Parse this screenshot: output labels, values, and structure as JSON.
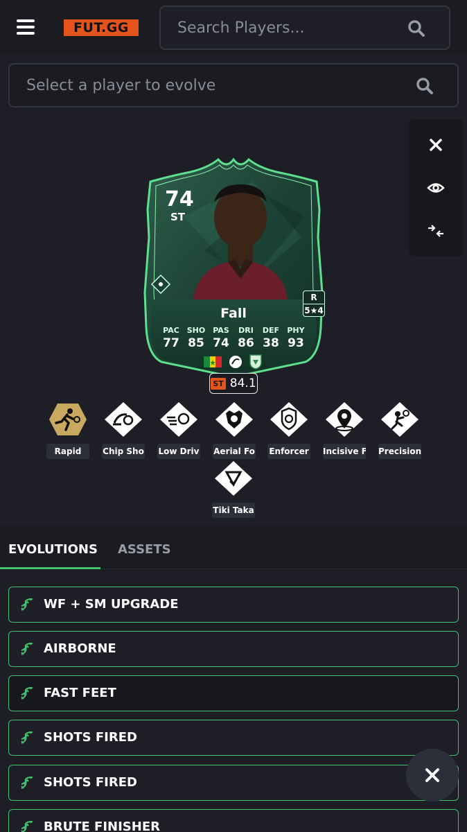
{
  "header": {
    "logo_text": "FUT.GG",
    "search_placeholder": "Search Players..."
  },
  "player_select": {
    "placeholder": "Select a player to evolve"
  },
  "card": {
    "rating": "74",
    "position": "ST",
    "name": "Fall",
    "foot": "R",
    "skills_weakfoot": "5★4",
    "stats": [
      {
        "label": "PAC",
        "value": "77"
      },
      {
        "label": "SHO",
        "value": "85"
      },
      {
        "label": "PAS",
        "value": "74"
      },
      {
        "label": "DRI",
        "value": "86"
      },
      {
        "label": "DEF",
        "value": "38"
      },
      {
        "label": "PHY",
        "value": "93"
      }
    ],
    "badge_position": "ST",
    "badge_rating": "84.1"
  },
  "playstyles": [
    {
      "label": "Rapid",
      "icon": "rapid-icon",
      "plus": true
    },
    {
      "label": "Chip Sho",
      "icon": "chip-shot-icon",
      "plus": false
    },
    {
      "label": "Low Driv",
      "icon": "low-driven-shot-icon",
      "plus": false
    },
    {
      "label": "Aerial Fo",
      "icon": "aerial-fortress-icon",
      "plus": false
    },
    {
      "label": "Enforcer",
      "icon": "enforcer-icon",
      "plus": false
    },
    {
      "label": "Incisive F",
      "icon": "incisive-pass-icon",
      "plus": false
    },
    {
      "label": "Precision",
      "icon": "precision-header-icon",
      "plus": false
    },
    {
      "label": "Tiki Taka",
      "icon": "tiki-taka-icon",
      "plus": false
    }
  ],
  "tabs": [
    {
      "label": "EVOLUTIONS",
      "active": true
    },
    {
      "label": "ASSETS",
      "active": false
    }
  ],
  "evolutions": [
    {
      "label": "WF + SM UPGRADE"
    },
    {
      "label": "AIRBORNE"
    },
    {
      "label": "FAST FEET"
    },
    {
      "label": "SHOTS FIRED"
    },
    {
      "label": "SHOTS FIRED"
    },
    {
      "label": "BRUTE FINISHER"
    }
  ],
  "colors": {
    "accent": "#3fc46f",
    "brand": "#e5541d",
    "gold": "#c9a860"
  }
}
